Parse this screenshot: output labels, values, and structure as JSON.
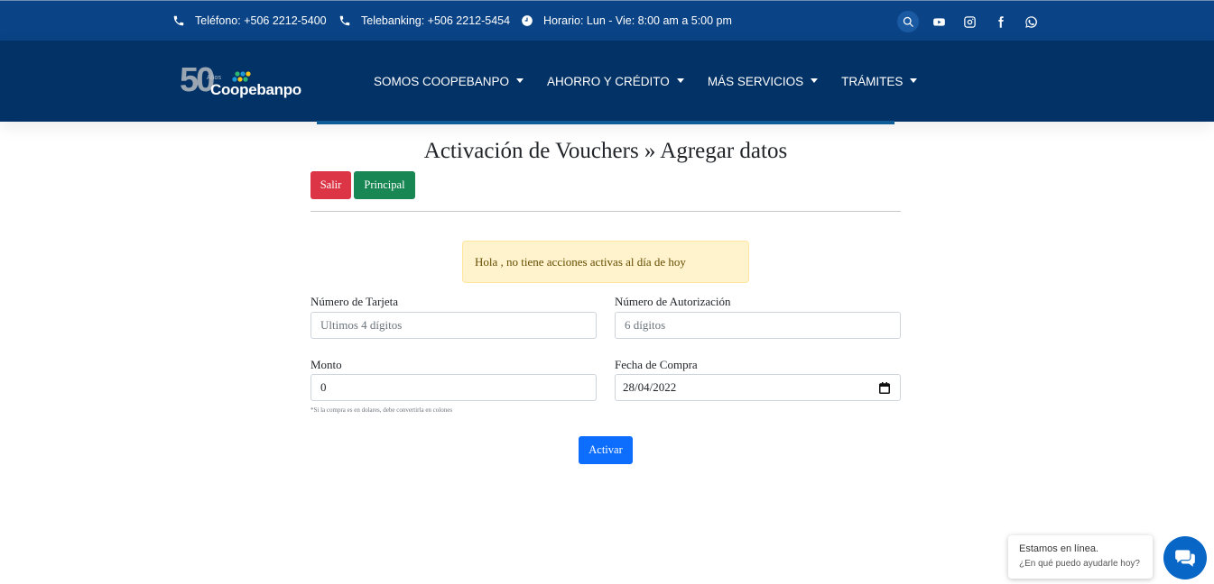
{
  "topbar": {
    "phone": "Teléfono: +506 2212-5400",
    "telebanking": "Telebanking: +506 2212-5454",
    "hours": "Horario: Lun - Vie: 8:00 am a 5:00 pm",
    "social": [
      "search-icon",
      "youtube-icon",
      "instagram-icon",
      "facebook-icon",
      "whatsapp-icon"
    ]
  },
  "nav": {
    "logo": {
      "number": "50",
      "years": "Años",
      "brand": "Coopebanpo"
    },
    "items": [
      {
        "label": "SOMOS COOPEBANPO"
      },
      {
        "label": "AHORRO Y CRÉDITO"
      },
      {
        "label": "MÁS SERVICIOS"
      },
      {
        "label": "TRÁMITES"
      }
    ]
  },
  "page": {
    "title": "Activación de Vouchers » Agregar datos",
    "buttons": {
      "salir": "Salir",
      "principal": "Principal"
    },
    "alert": "Hola , no tiene acciones activas al día de hoy",
    "form": {
      "card_label": "Número de Tarjeta",
      "card_placeholder": "Ultimos 4 dígitos",
      "auth_label": "Número de Autorización",
      "auth_placeholder": "6 dígitos",
      "amount_label": "Monto",
      "amount_value": "0",
      "date_label": "Fecha de Compra",
      "date_value": "28/04/2022",
      "note": "*Si la compra es en dolares, debe convertirla en colones",
      "submit": "Activar"
    }
  },
  "chat": {
    "line1": "Estamos en línea.",
    "line2": "¿En qué puedo ayudarle hoy?"
  },
  "colors": {
    "topbar": "#0b4486",
    "navbar": "#033266",
    "danger": "#dc3545",
    "success": "#198754",
    "primary": "#0d6efd",
    "alert_bg": "#fff3cd"
  }
}
